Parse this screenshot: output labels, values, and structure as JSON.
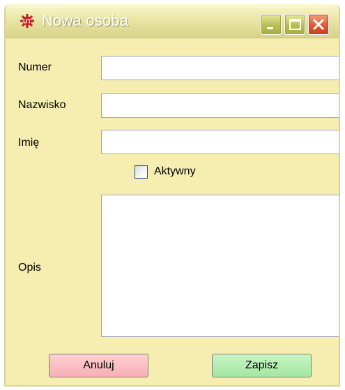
{
  "window": {
    "title": "Nowa osoba",
    "icon": "app-gear-icon",
    "controls": [
      "minimize-icon",
      "maximize-icon",
      "close-icon"
    ]
  },
  "form": {
    "numer_label": "Numer",
    "numer_value": "",
    "nazwisko_label": "Nazwisko",
    "nazwisko_value": "",
    "imie_label": "Imię",
    "imie_value": "",
    "aktywny_label": "Aktywny",
    "aktywny_checked": false,
    "opis_label": "Opis",
    "opis_value": ""
  },
  "buttons": {
    "cancel_label": "Anuluj",
    "save_label": "Zapisz"
  },
  "colors": {
    "background": "#f6eeb0",
    "cancel_button": "#f6b0b6",
    "save_button": "#a3e6a1",
    "close_button": "#df5a34"
  }
}
